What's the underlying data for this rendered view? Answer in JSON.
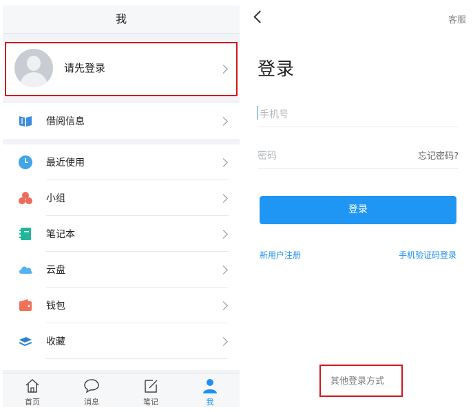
{
  "left": {
    "title": "我",
    "profile_label": "请先登录",
    "menu_top": [
      {
        "label": "借阅信息",
        "icon": "book-icon"
      }
    ],
    "menu_main": [
      {
        "label": "最近使用",
        "icon": "clock-icon"
      },
      {
        "label": "小组",
        "icon": "group-icon"
      },
      {
        "label": "笔记本",
        "icon": "notebook-icon"
      },
      {
        "label": "云盘",
        "icon": "cloud-icon"
      },
      {
        "label": "钱包",
        "icon": "wallet-icon"
      },
      {
        "label": "收藏",
        "icon": "layers-icon"
      }
    ],
    "tabs": [
      {
        "label": "首页",
        "icon": "home-icon"
      },
      {
        "label": "消息",
        "icon": "chat-icon"
      },
      {
        "label": "笔记",
        "icon": "edit-icon"
      },
      {
        "label": "我",
        "icon": "user-icon",
        "active": true
      }
    ]
  },
  "right": {
    "service": "客服",
    "title": "登录",
    "phone_placeholder": "手机号",
    "password_placeholder": "密码",
    "forgot": "忘记密码?",
    "login_button": "登录",
    "register": "新用户注册",
    "sms_login": "手机验证码登录",
    "other_login": "其他登录方式"
  },
  "colors": {
    "accent": "#1f96f3",
    "highlight_box": "#d0171c"
  }
}
